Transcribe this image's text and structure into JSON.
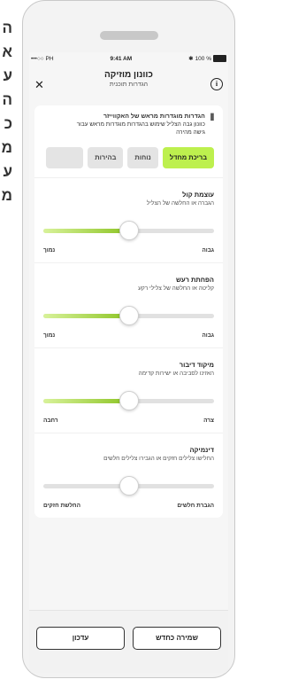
{
  "background_text": [
    "ה",
    "א",
    "ע",
    "ה",
    "כ",
    "מ",
    "ע",
    "מ"
  ],
  "status_bar": {
    "carrier": "•••○○ PH",
    "time": "9:41 AM",
    "battery": "100 %"
  },
  "header": {
    "title": "כוונון מוזיקה",
    "subtitle": "הגדרות תוכנית"
  },
  "presets": {
    "title": "הגדרות מוגדרות מראש של האקווייזר",
    "description": "כוונון גבה הצליל שימוש בהגדרות מוגדרות מראש עבור גישה מהירה",
    "chips": [
      {
        "label": "בריכת מחדל",
        "active": true
      },
      {
        "label": "נוחות",
        "active": false
      },
      {
        "label": "בהירות",
        "active": false
      },
      {
        "label": "",
        "active": false
      }
    ]
  },
  "settings": [
    {
      "title": "עוצמת קול",
      "description": "הגברה או החלשה של הצליל",
      "value": 0.5,
      "min_label": "נמוך",
      "max_label": "גבוה"
    },
    {
      "title": "הפחתת רעש",
      "description": "קליטה או החלשה של צלילי רקע",
      "value": 0.5,
      "min_label": "נמוך",
      "max_label": "גבוה"
    },
    {
      "title": "מיקוד דיבור",
      "description": "האזינו לסביבה או ישירות קדימה",
      "value": 0.5,
      "min_label": "רחבה",
      "max_label": "צרה"
    },
    {
      "title": "דינמיקה",
      "description": "החלישו צלילים חזקים או הגבירו צלילים חלשים",
      "value": 0.5,
      "min_label": "החלשת חזקים",
      "max_label": "הגברת חלשים"
    }
  ],
  "footer": {
    "save_new_label": "שמירה כחדש",
    "update_label": "עדכון"
  },
  "colors": {
    "accent": "#bdf04e",
    "slider_fill": "#8cc424"
  }
}
